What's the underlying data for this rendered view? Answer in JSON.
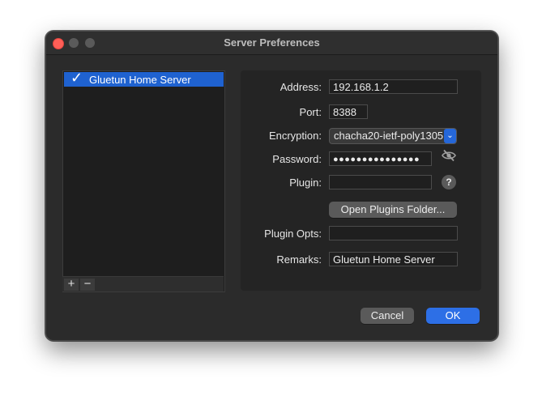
{
  "window": {
    "title": "Server Preferences"
  },
  "servers": [
    {
      "label": "Gluetun Home Server",
      "selected": true
    }
  ],
  "list_controls": {
    "add": "+",
    "remove": "−"
  },
  "form": {
    "address_label": "Address:",
    "address_value": "192.168.1.2",
    "port_label": "Port:",
    "port_value": "8388",
    "encryption_label": "Encryption:",
    "encryption_value": "chacha20-ietf-poly1305",
    "password_label": "Password:",
    "password_value": "●●●●●●●●●●●●●●●",
    "plugin_label": "Plugin:",
    "plugin_value": "",
    "help_text": "?",
    "open_plugins_button": "Open Plugins Folder...",
    "plugin_opts_label": "Plugin Opts:",
    "plugin_opts_value": "",
    "remarks_label": "Remarks:",
    "remarks_value": "Gluetun Home Server"
  },
  "actions": {
    "cancel": "Cancel",
    "ok": "OK"
  },
  "colors": {
    "accent": "#2d6fe6",
    "selection": "#1f62d0",
    "close": "#ff5f57"
  },
  "icons": {
    "eye": "eye-slash-icon",
    "check": "checkmark-icon",
    "help": "help-icon",
    "popup": "chevron-updown-icon"
  }
}
